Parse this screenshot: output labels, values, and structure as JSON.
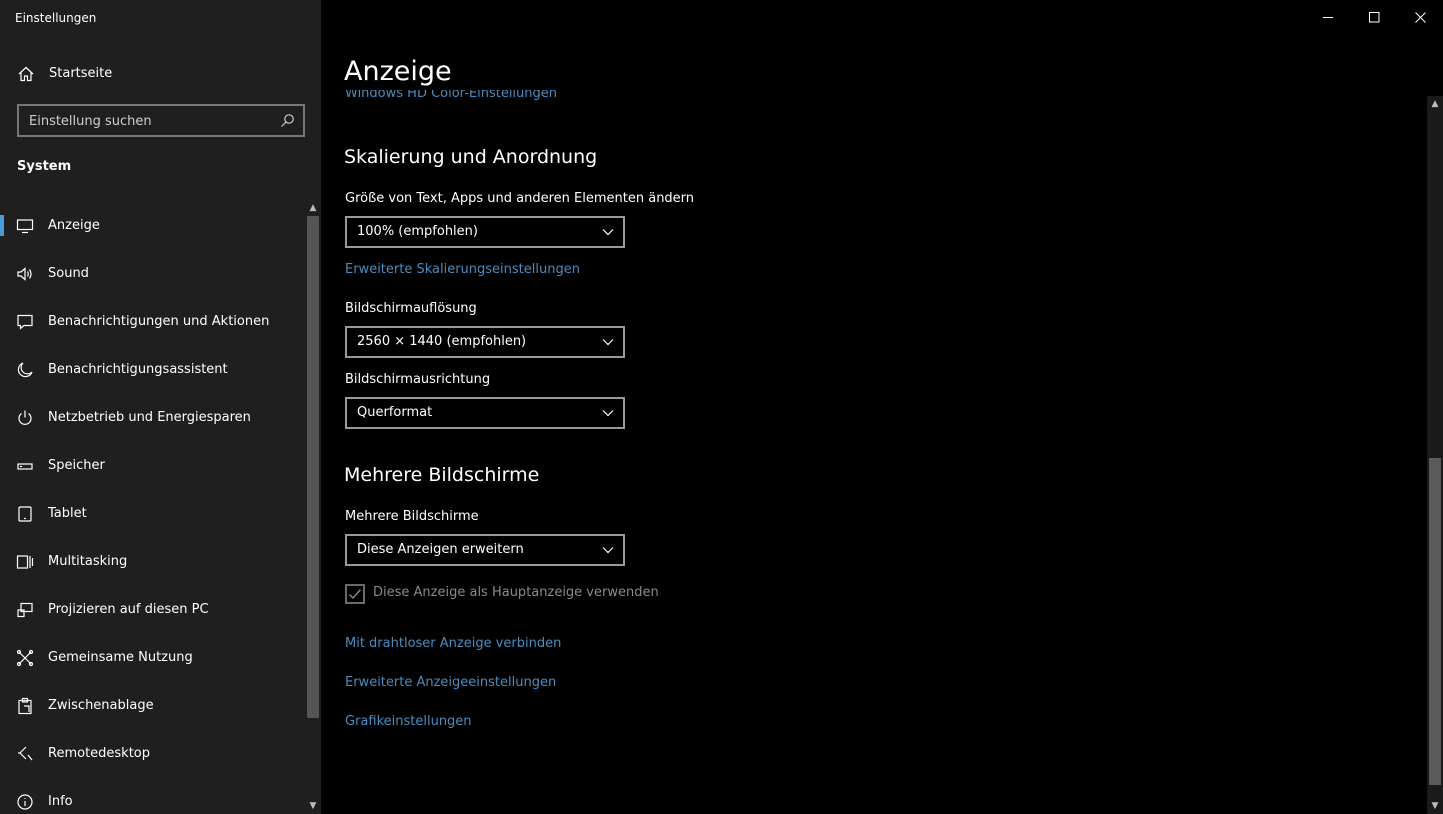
{
  "window": {
    "title": "Einstellungen",
    "controls": {
      "minimize": "—",
      "maximize": "☐",
      "close": "✕"
    }
  },
  "sidebar": {
    "home_label": "Startseite",
    "search_placeholder": "Einstellung suchen",
    "section": "System",
    "items": [
      {
        "label": "Anzeige",
        "icon": "monitor-icon",
        "selected": true
      },
      {
        "label": "Sound",
        "icon": "speaker-icon"
      },
      {
        "label": "Benachrichtigungen und Aktionen",
        "icon": "message-icon"
      },
      {
        "label": "Benachrichtigungsassistent",
        "icon": "moon-icon"
      },
      {
        "label": "Netzbetrieb und Energiesparen",
        "icon": "power-icon"
      },
      {
        "label": "Speicher",
        "icon": "storage-icon"
      },
      {
        "label": "Tablet",
        "icon": "tablet-icon"
      },
      {
        "label": "Multitasking",
        "icon": "multitasking-icon"
      },
      {
        "label": "Projizieren auf diesen PC",
        "icon": "project-icon"
      },
      {
        "label": "Gemeinsame Nutzung",
        "icon": "share-icon"
      },
      {
        "label": "Zwischenablage",
        "icon": "clipboard-icon"
      },
      {
        "label": "Remotedesktop",
        "icon": "remote-icon"
      },
      {
        "label": "Info",
        "icon": "info-icon"
      }
    ]
  },
  "main": {
    "title": "Anzeige",
    "cut_link": "Windows HD Color-Einstellungen",
    "scaling": {
      "heading": "Skalierung und Anordnung",
      "size_label": "Größe von Text, Apps und anderen Elementen ändern",
      "size_value": "100% (empfohlen)",
      "advanced_link": "Erweiterte Skalierungseinstellungen",
      "resolution_label": "Bildschirmauflösung",
      "resolution_value": "2560 × 1440 (empfohlen)",
      "orientation_label": "Bildschirmausrichtung",
      "orientation_value": "Querformat"
    },
    "multi": {
      "heading": "Mehrere Bildschirme",
      "label": "Mehrere Bildschirme",
      "value": "Diese Anzeigen erweitern",
      "checkbox_label": "Diese Anzeige als Hauptanzeige verwenden",
      "checkbox_checked": true
    },
    "links": {
      "wireless": "Mit drahtloser Anzeige verbinden",
      "advanced_display": "Erweiterte Anzeigeeinstellungen",
      "graphics": "Grafikeinstellungen"
    }
  },
  "colors": {
    "accent": "#4a9ad4",
    "link": "#4a8cbf",
    "sidebar_bg": "#1f1f1f",
    "main_bg": "#000000"
  }
}
